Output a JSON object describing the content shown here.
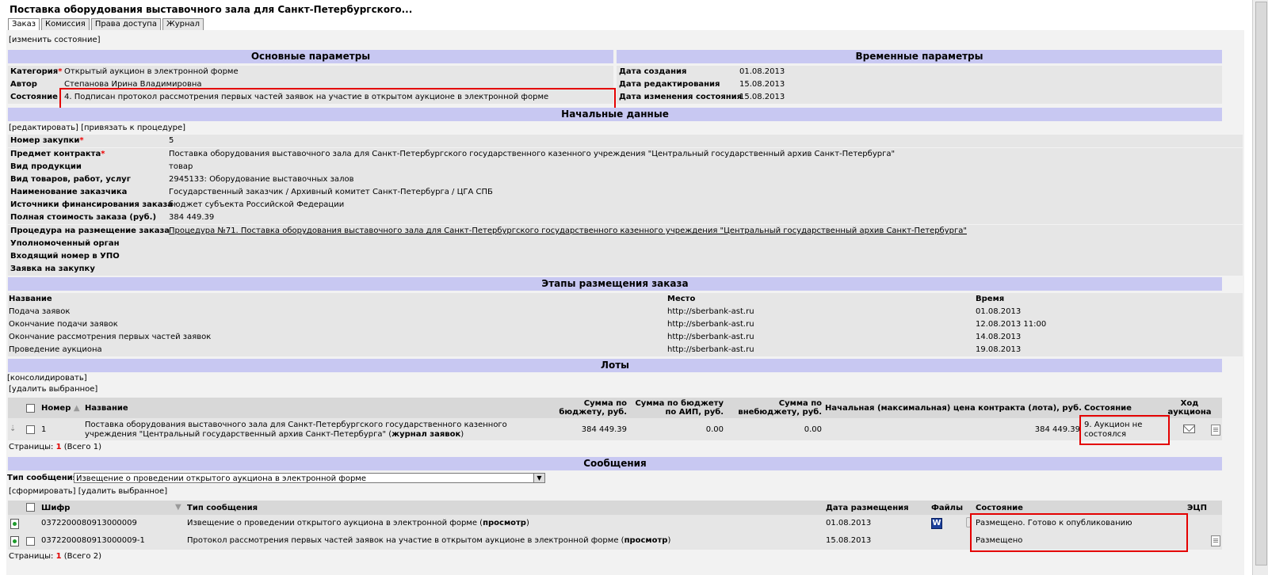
{
  "title": "Поставка оборудования выставочного зала для Санкт-Петербургского...",
  "tabs": [
    "Заказ",
    "Комиссия",
    "Права доступа",
    "Журнал"
  ],
  "change_state": "[изменить состояние]",
  "main_params": {
    "header": "Основные параметры",
    "category_label": "Категория",
    "category_value": "Открытый аукцион в электронной форме",
    "author_label": "Автор",
    "author_value": "Степанова Ирина Владимировна",
    "state_label": "Состояние",
    "state_value": "4. Подписан протокол рассмотрения первых частей заявок на участие в открытом аукционе в электронной форме"
  },
  "time_params": {
    "header": "Временные параметры",
    "created_label": "Дата создания",
    "created_value": "01.08.2013",
    "edited_label": "Дата редактирования",
    "edited_value": "15.08.2013",
    "state_changed_label": "Дата изменения состояния",
    "state_changed_value": "15.08.2013"
  },
  "initial_data": {
    "header": "Начальные данные",
    "edit": "[редактировать]",
    "bind": "[привязать к процедуре]",
    "rows": [
      {
        "label": "Номер закупки",
        "req": "*",
        "value": "5"
      },
      {
        "label": "Предмет контракта",
        "req": "*",
        "value": "Поставка оборудования выставочного зала для Санкт-Петербургского государственного казенного учреждения \"Центральный государственный архив Санкт-Петербурга\""
      },
      {
        "label": "Вид продукции",
        "req": "",
        "value": "товар"
      },
      {
        "label": "Вид товаров, работ, услуг",
        "req": "",
        "value": "2945133: Оборудование выставочных залов"
      },
      {
        "label": "Наименование заказчика",
        "req": "",
        "value": "Государственный заказчик / Архивный комитет Санкт-Петербурга / ЦГА СПБ"
      },
      {
        "label": "Источники финансирования заказа",
        "req": "",
        "value": "бюджет субъекта Российской Федерации"
      },
      {
        "label": "Полная стоимость заказа (руб.)",
        "req": "",
        "value": "384 449.39"
      },
      {
        "label": "Процедура на размещение заказа",
        "req": "",
        "value": "Процедура №71. Поставка оборудования выставочного зала для Санкт-Петербургского государственного казенного учреждения \"Центральный государственный архив Санкт-Петербурга\""
      },
      {
        "label": "Уполномоченный орган",
        "req": "",
        "value": ""
      },
      {
        "label": "Входящий номер в УПО",
        "req": "",
        "value": ""
      },
      {
        "label": "Заявка на закупку",
        "req": "",
        "value": ""
      }
    ]
  },
  "stages": {
    "header": "Этапы размещения заказа",
    "col_name": "Название",
    "col_place": "Место",
    "col_time": "Время",
    "rows": [
      {
        "name": "Подача заявок",
        "place": "http://sberbank-ast.ru",
        "time": "01.08.2013"
      },
      {
        "name": "Окончание подачи заявок",
        "place": "http://sberbank-ast.ru",
        "time": "12.08.2013 11:00"
      },
      {
        "name": "Окончание рассмотрения первых частей заявок",
        "place": "http://sberbank-ast.ru",
        "time": "14.08.2013"
      },
      {
        "name": "Проведение аукциона",
        "place": "http://sberbank-ast.ru",
        "time": "19.08.2013"
      }
    ]
  },
  "lots": {
    "header": "Лоты",
    "consolidate": "[консолидировать]",
    "delete_selected": "[удалить выбранное]",
    "col_number": "Номер",
    "col_name": "Название",
    "col_budget_1": "Сумма по",
    "col_budget_2": "бюджету, руб.",
    "col_aip_1": "Сумма по бюджету",
    "col_aip_2": "по АИП, руб.",
    "col_extra_1": "Сумма по",
    "col_extra_2": "внебюджету, руб.",
    "col_price": "Начальная (максимальная) цена контракта (лота), руб.",
    "col_state": "Состояние",
    "col_auction_1": "Ход",
    "col_auction_2": "аукциона",
    "row": {
      "number": "1",
      "name_1": "Поставка оборудования выставочного зала для Санкт-Петербургского государственного казенного",
      "name_2": "учреждения \"Центральный государственный архив Санкт-Петербурга\" (",
      "name_link": "журнал заявок",
      "name_end": ")",
      "budget": "384 449.39",
      "aip": "0.00",
      "extra": "0.00",
      "price": "384 449.39",
      "state_1": "9. Аукцион не",
      "state_2": "состоялся"
    },
    "pages_label": "Страницы:",
    "pages_current": "1",
    "pages_total": "(Всего 1)"
  },
  "messages": {
    "header": "Сообщения",
    "type_label": "Тип сообщения",
    "type_value": "Извещение о проведении открытого аукциона в электронной форме",
    "form": "[сформировать]",
    "delete_selected": "[удалить выбранное]",
    "col_code": "Шифр",
    "col_type": "Тип сообщения",
    "col_date": "Дата размещения",
    "col_files": "Файлы",
    "col_state": "Состояние",
    "col_ecp": "ЭЦП",
    "rows": [
      {
        "code": "0372200080913000009",
        "type": "Извещение о проведении открытого аукциона в электронной форме (",
        "link": "просмотр",
        "end": ")",
        "date": "01.08.2013",
        "state": "Размещено. Готово к опубликованию"
      },
      {
        "code": "0372200080913000009-1",
        "type": "Протокол рассмотрения первых частей заявок на участие в открытом аукционе в электронной форме (",
        "link": "просмотр",
        "end": ")",
        "date": "15.08.2013",
        "state": "Размещено"
      }
    ],
    "pages_label": "Страницы:",
    "pages_current": "1",
    "pages_total": "(Всего 2)"
  },
  "colors": {
    "header_bg": "#c8c8f2",
    "row_bg": "#e6e6e6",
    "highlight": "#e40000",
    "page_current": "#e00000"
  }
}
